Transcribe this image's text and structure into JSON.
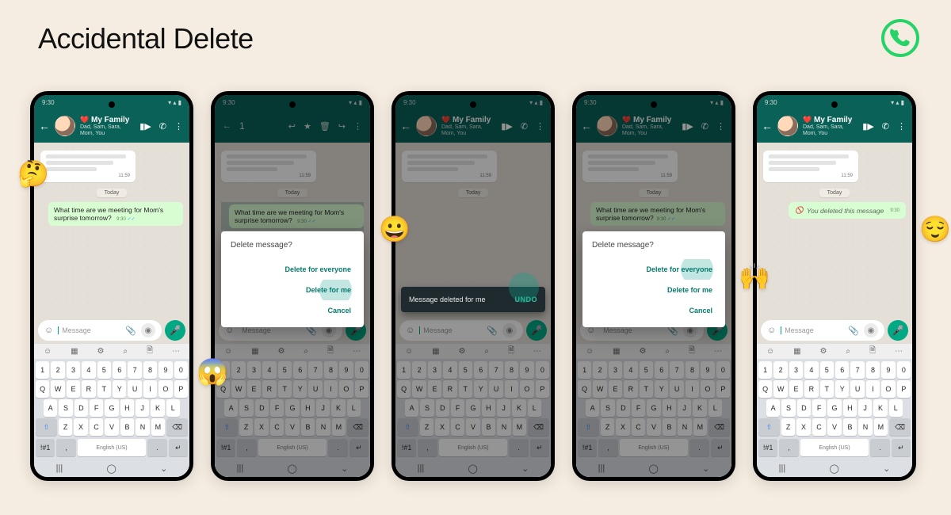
{
  "page_title": "Accidental Delete",
  "status_time": "9:30",
  "chat": {
    "title_emoji": "❤️",
    "title": "My Family",
    "subtitle": "Dad, Sam, Sara, Mom, You"
  },
  "date_chip": "Today",
  "incoming_time": "11:59",
  "message_text": "What time are we meeting for Mom's surprise tomorrow?",
  "message_time": "9:30",
  "deleted_text": "You deleted this message",
  "input_placeholder": "Message",
  "selection_count": "1",
  "dialog": {
    "title": "Delete message?",
    "opt_everyone": "Delete for everyone",
    "opt_me": "Delete for me",
    "opt_cancel": "Cancel"
  },
  "snackbar": {
    "msg": "Message deleted for me",
    "undo": "UNDO"
  },
  "keyboard": {
    "row1": [
      "1",
      "2",
      "3",
      "4",
      "5",
      "6",
      "7",
      "8",
      "9",
      "0"
    ],
    "row2": [
      "Q",
      "W",
      "E",
      "R",
      "T",
      "Y",
      "U",
      "I",
      "O",
      "P"
    ],
    "row3": [
      "A",
      "S",
      "D",
      "F",
      "G",
      "H",
      "J",
      "K",
      "L"
    ],
    "row4": [
      "Z",
      "X",
      "C",
      "V",
      "B",
      "N",
      "M"
    ],
    "lang": "English (US)",
    "sym": "!#1"
  },
  "emojis": {
    "thinking": "🤔",
    "scream": "😱",
    "grin": "😀",
    "raised_hands": "🙌",
    "relieved": "😌"
  }
}
